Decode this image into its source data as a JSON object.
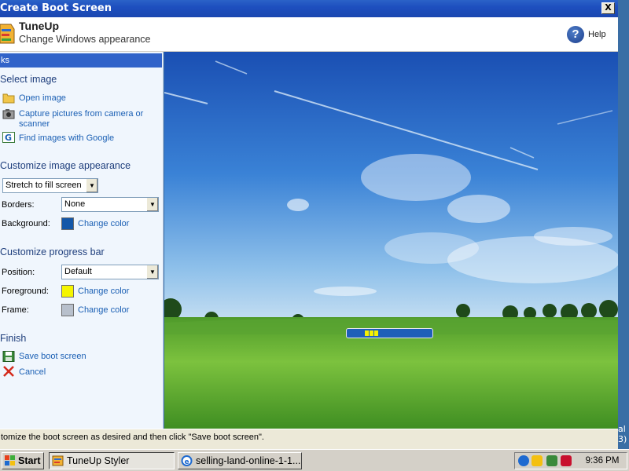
{
  "window": {
    "title": "Create Boot Screen",
    "close_label": "X"
  },
  "header": {
    "app_name": "TuneUp",
    "subtitle": "Change Windows appearance",
    "help_label": "Help"
  },
  "left_panel": {
    "tasks_label": "ks",
    "select_image": {
      "heading": "Select image",
      "open_image": "Open image",
      "capture": "Capture pictures from camera or scanner",
      "find_google": "Find images with Google"
    },
    "appearance": {
      "heading": "Customize image appearance",
      "stretch_value": "Stretch to fill screen",
      "borders_label": "Borders:",
      "borders_value": "None",
      "background_label": "Background:",
      "background_link": "Change color",
      "background_color": "#1457a8"
    },
    "progress_bar": {
      "heading": "Customize progress bar",
      "position_label": "Position:",
      "position_value": "Default",
      "foreground_label": "Foreground:",
      "foreground_link": "Change color",
      "foreground_color": "#f5f500",
      "frame_label": "Frame:",
      "frame_link": "Change color",
      "frame_color": "#b8c0cc"
    },
    "finish": {
      "heading": "Finish",
      "save": "Save boot screen",
      "cancel": "Cancel"
    }
  },
  "status": {
    "text": "tomize the boot screen as desired and then click \"Save boot screen\"."
  },
  "right_edge": {
    "text_1": "al",
    "text_2": "3)"
  },
  "taskbar": {
    "start_label": "Start",
    "buttons": [
      {
        "label": "TuneUp Styler",
        "icon": "tuneup-icon"
      },
      {
        "label": "selling-land-online-1-1...",
        "icon": "ie-icon"
      }
    ],
    "clock": "9:36 PM"
  }
}
